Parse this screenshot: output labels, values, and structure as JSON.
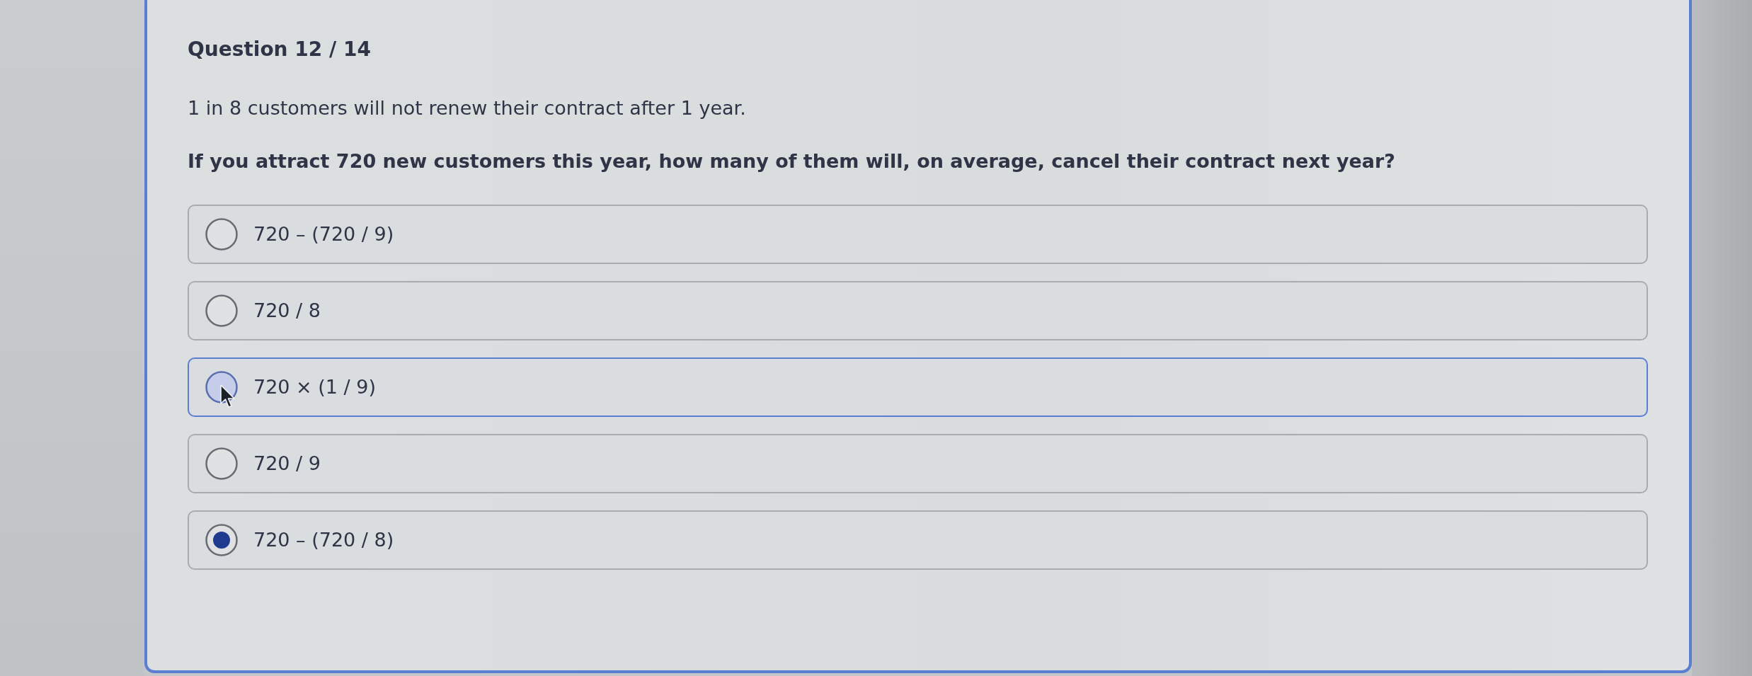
{
  "question": {
    "header": "Question 12 / 14",
    "statement": "1 in 8 customers will not renew their contract after 1 year.",
    "prompt": "If you attract 720 new customers this year, how many of them will, on average, cancel their contract next year?"
  },
  "options": [
    {
      "label": "720 – (720 / 9)",
      "selected": false,
      "hovered": false
    },
    {
      "label": "720 / 8",
      "selected": false,
      "hovered": false
    },
    {
      "label": "720 × (1 / 9)",
      "selected": false,
      "hovered": true
    },
    {
      "label": "720 / 9",
      "selected": false,
      "hovered": false
    },
    {
      "label": "720 – (720 / 8)",
      "selected": true,
      "hovered": false
    }
  ]
}
